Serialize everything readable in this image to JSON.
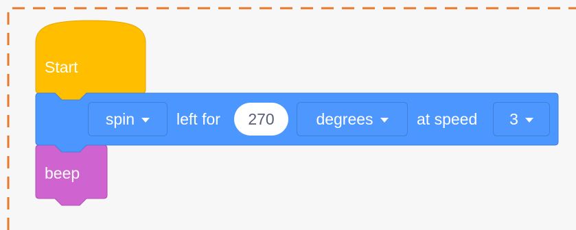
{
  "blocks": {
    "start": {
      "label": "Start",
      "color": "#ffbf00"
    },
    "spin": {
      "color": "#4c97ff",
      "direction": {
        "value": "spin",
        "icon": "caret-down-icon"
      },
      "text_left_for": "left for",
      "amount": "270",
      "unit": {
        "value": "degrees",
        "icon": "caret-down-icon"
      },
      "text_at_speed": "at speed",
      "speed": {
        "value": "3",
        "icon": "caret-down-icon"
      }
    },
    "beep": {
      "label": "beep",
      "color": "#cf63cf"
    }
  },
  "frame": {
    "border_color": "#e8782a",
    "style": "dashed"
  }
}
